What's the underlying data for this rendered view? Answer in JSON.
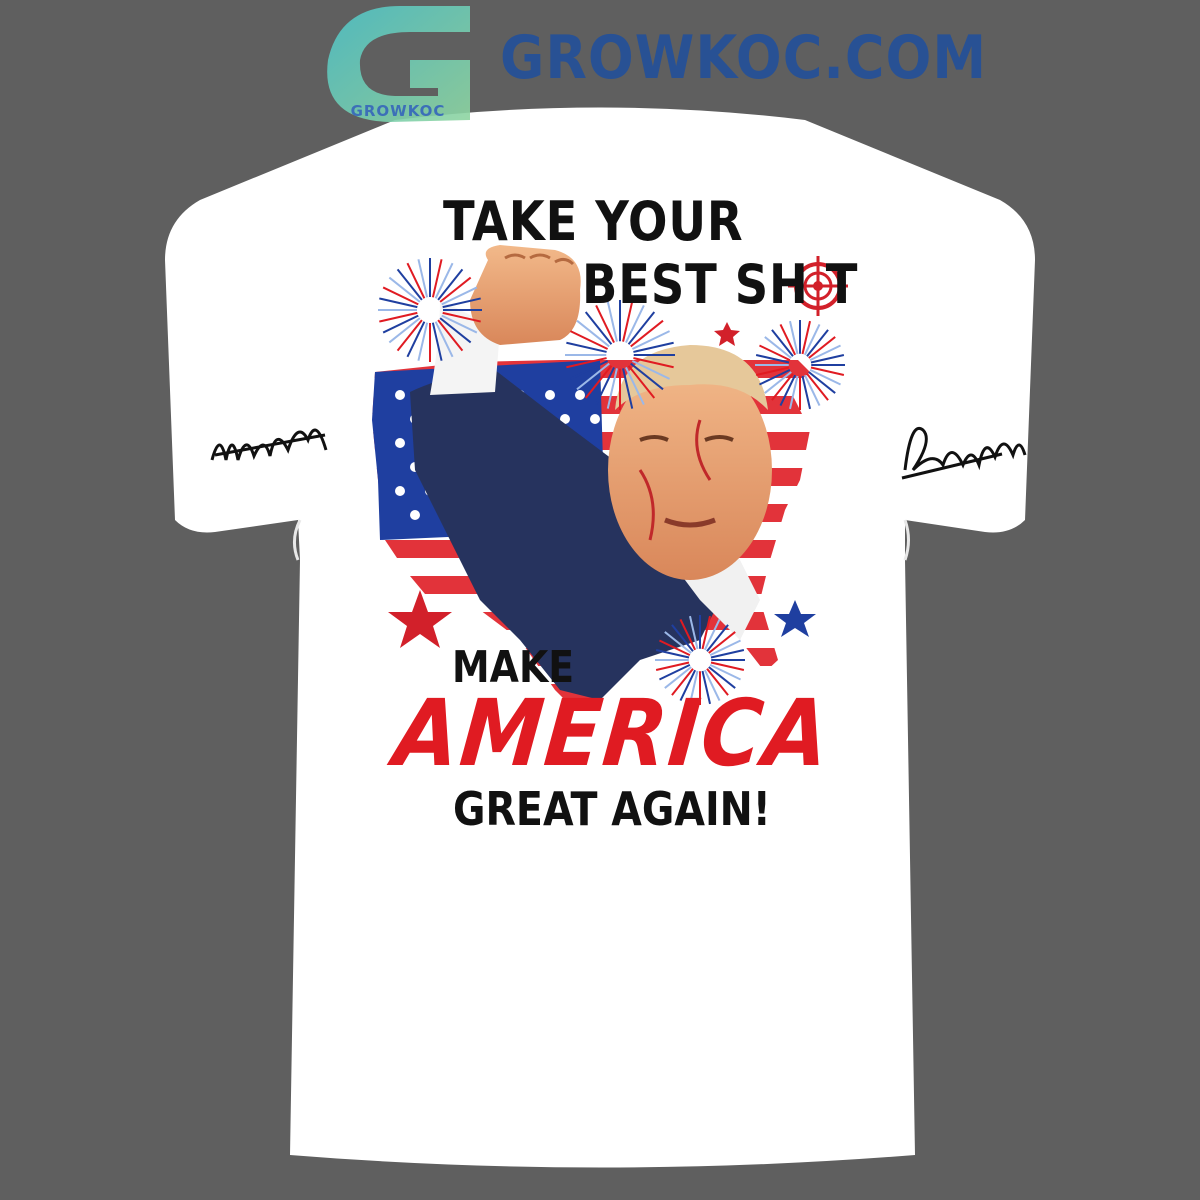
{
  "watermark": {
    "site_name": "GROWKOC.COM",
    "logo_caption": "GROWKOC"
  },
  "shirt": {
    "headline_line1": "TAKE YOUR",
    "headline_line2": "BEST SH  T",
    "slogan_line1": "MAKE",
    "slogan_line2": "AMERICA",
    "slogan_line3": "GREAT AGAIN!"
  },
  "colors": {
    "background": "#5f5f5f",
    "shirt": "#ffffff",
    "accent_red": "#e01b22",
    "accent_blue": "#1f3fa0",
    "watermark_blue": "#1f4f9e",
    "watermark_teal": "#4fc3c8"
  },
  "icons": [
    "target-crosshair-icon",
    "star-icon",
    "firework-icon"
  ]
}
